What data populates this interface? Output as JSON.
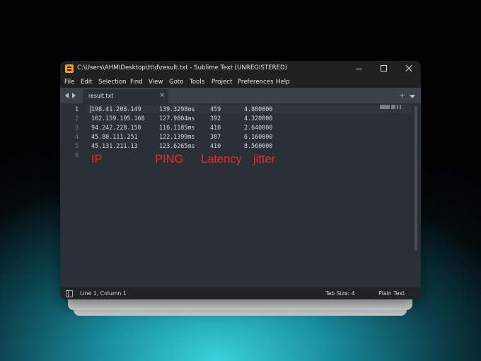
{
  "window": {
    "title": "C:\\Users\\AHM\\Desktop\\tt\\d\\result.txt - Sublime Text (UNREGISTERED)"
  },
  "menu": [
    "File",
    "Edit",
    "Selection",
    "Find",
    "View",
    "Goto",
    "Tools",
    "Project",
    "Preferences",
    "Help"
  ],
  "tab": {
    "label": "result.txt",
    "close": "×",
    "plus": "+"
  },
  "editor": {
    "line_numbers": [
      "1",
      "2",
      "3",
      "4",
      "5",
      "6"
    ],
    "rows": [
      {
        "ip": "198.41.208.149",
        "ping": "139.3298ms",
        "latency": "459",
        "jitter": "4.880000"
      },
      {
        "ip": "162.159.195.168",
        "ping": "127.9804ms",
        "latency": "392",
        "jitter": "4.320000"
      },
      {
        "ip": "94.242.228.150",
        "ping": "116.1185ms",
        "latency": "410",
        "jitter": "2.640000"
      },
      {
        "ip": "45.80.111.251",
        "ping": "122.1399ms",
        "latency": "387",
        "jitter": "6.160000"
      },
      {
        "ip": "45.131.211.13",
        "ping": "123.6265ms",
        "latency": "410",
        "jitter": "8.560000"
      }
    ],
    "annotations": {
      "ip": "IP",
      "ping": "PING",
      "latency": "Latency",
      "jitter": "jitter"
    }
  },
  "status": {
    "position": "Line 1, Column 1",
    "tab_size": "Tab Size: 4",
    "syntax": "Plain Text"
  },
  "colors": {
    "annotation": "#ea2a2a",
    "app_icon": "#f29a1f"
  }
}
